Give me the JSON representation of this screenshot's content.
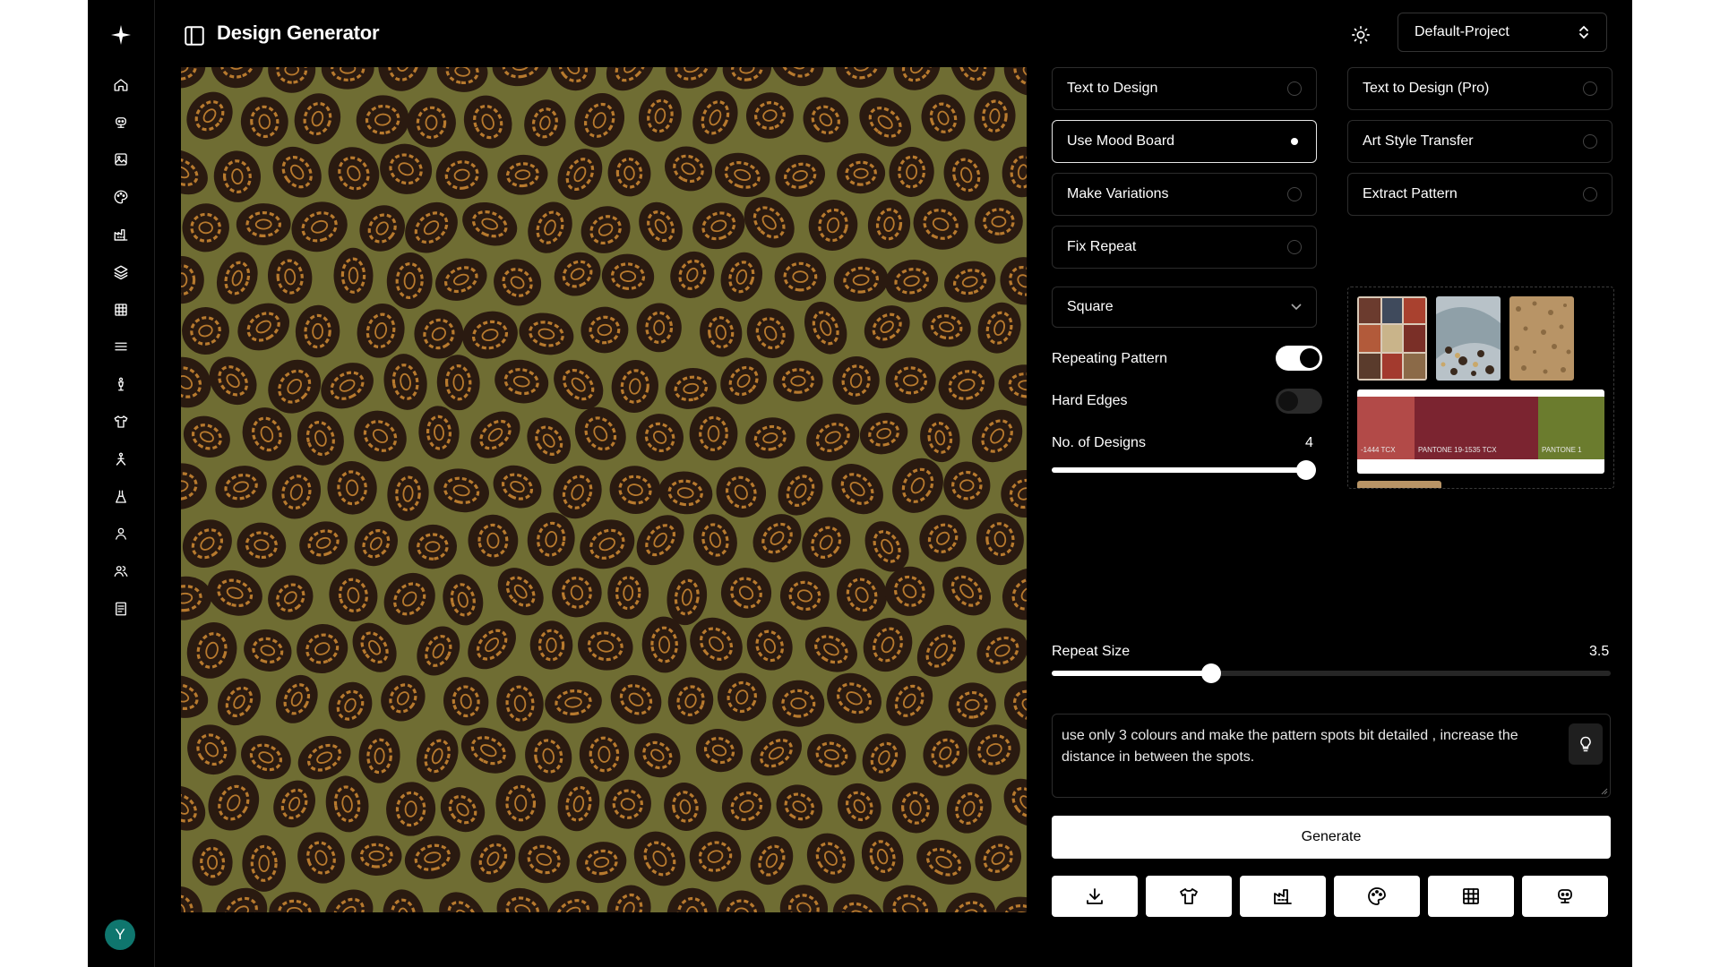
{
  "header": {
    "title": "Design Generator",
    "project": "Default-Project"
  },
  "user": {
    "avatar_initial": "Y",
    "avatar_color": "#0f766e"
  },
  "sidebar": {
    "items": [
      "home-icon",
      "robot-icon",
      "image-icon",
      "palette-icon",
      "factory-icon",
      "layers-icon",
      "grid-icon",
      "menu-icon",
      "mannequin-icon",
      "shirt-icon",
      "figure-icon",
      "dress-icon",
      "user-icon",
      "users-icon",
      "document-icon"
    ]
  },
  "options": {
    "left": [
      {
        "label": "Text to Design",
        "selected": false
      },
      {
        "label": "Use Mood Board",
        "selected": true
      },
      {
        "label": "Make Variations",
        "selected": false
      },
      {
        "label": "Fix Repeat",
        "selected": false
      }
    ],
    "right": [
      {
        "label": "Text to Design (Pro)",
        "selected": false
      },
      {
        "label": "Art Style Transfer",
        "selected": false
      },
      {
        "label": "Extract Pattern",
        "selected": false
      }
    ]
  },
  "shape": {
    "value": "Square"
  },
  "repeating_pattern": {
    "label": "Repeating Pattern",
    "on": true
  },
  "hard_edges": {
    "label": "Hard Edges",
    "on": false
  },
  "designs": {
    "label": "No. of Designs",
    "value": "4",
    "fraction": 1.0
  },
  "repeat_size": {
    "label": "Repeat Size",
    "value": "3.5",
    "fraction": 0.286
  },
  "moodboard": {
    "swatches": [
      {
        "label": "-1444 TCX",
        "color": "#b24a48"
      },
      {
        "label": "PANTONE 19-1535 TCX",
        "color": "#7b2430"
      },
      {
        "label": "PANTONE 1",
        "color": "#6b7c2e"
      }
    ]
  },
  "prompt": {
    "text": "use only 3 colours and make the pattern spots bit detailed , increase the distance in between the spots."
  },
  "generate_label": "Generate",
  "tools": [
    "download-icon",
    "shirt-icon",
    "factory-icon",
    "palette-icon",
    "grid-icon",
    "robot-icon"
  ],
  "pattern_colors": {
    "background": "#6f6d33",
    "spot": "#2a1a10",
    "rosette": "#b87a2e"
  }
}
